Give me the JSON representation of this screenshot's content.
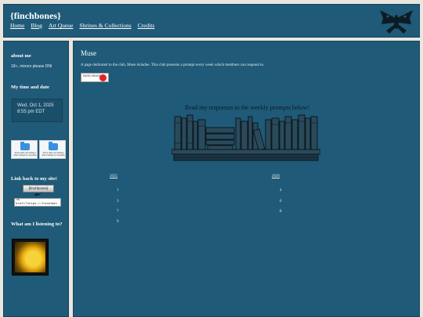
{
  "header": {
    "title": "{finchbones}",
    "nav": [
      "Home",
      "Blog",
      "Art Queue",
      "Shrines & Collections",
      "Credits"
    ]
  },
  "sidebar": {
    "about_heading": "about me",
    "about_text": "18+, minors please DNI",
    "time_heading": "My time and date",
    "time_line1": "Wed, Oct 1, 2025",
    "time_line2": "8:55 pm EDT",
    "badge1_caption": "Some sites not working when hosted on neocities",
    "badge2_caption": "Some sites not working when hosted on neocities",
    "link_heading": "Link back to my site!",
    "link_button": "{finchbones}",
    "link_code": "<a\nhref=\"https://finchbon",
    "listening_heading": "What am I listening to?"
  },
  "main": {
    "title": "Muse",
    "description": "A page dedicated to the club, Muse Ariadne. This club presents a prompt every week which members can respond to.",
    "badge_text": "MUSE ARIADNE",
    "prompt_heading": "Read my responses to the weekly prompts below!",
    "col1_heading": "2025",
    "col2_heading": "2026",
    "col1_numbers": [
      "1",
      "3",
      "7",
      "9"
    ],
    "col2_numbers": [
      "4",
      "6",
      "8"
    ]
  },
  "colors": {
    "panel": "#1f5a78",
    "background": "#e9e6df",
    "accent_red": "#e02525"
  }
}
